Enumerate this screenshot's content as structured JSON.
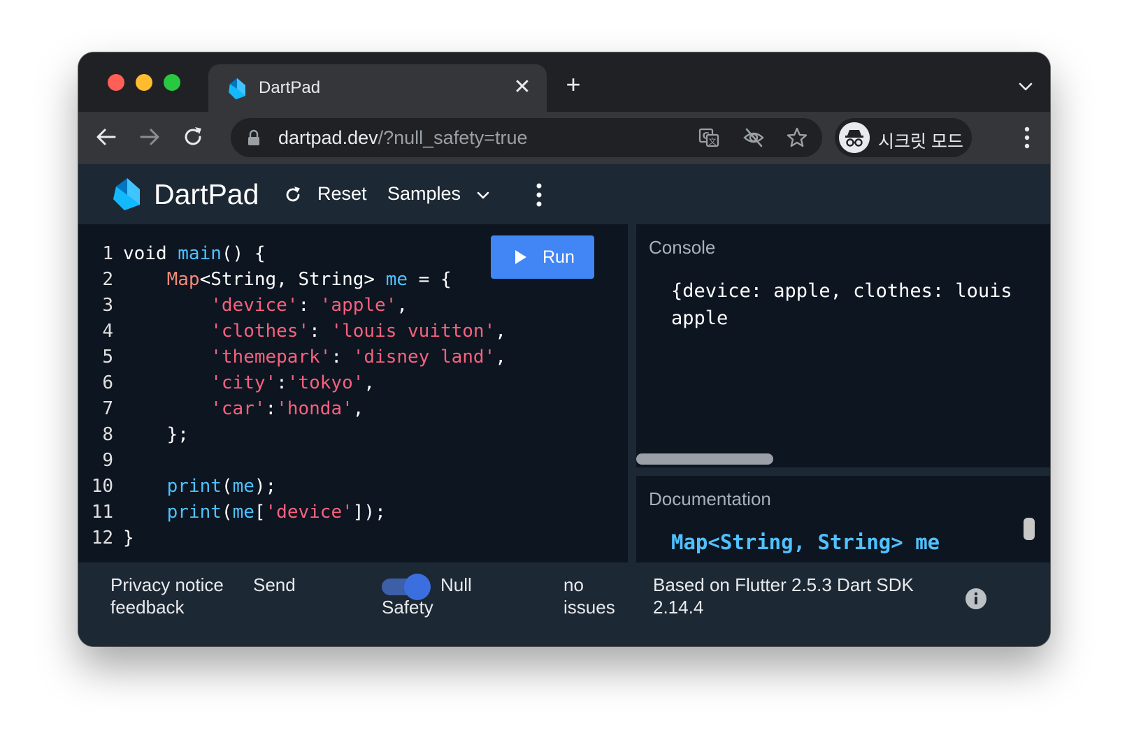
{
  "browser": {
    "tab_title": "DartPad",
    "tab_close": "✕",
    "new_tab": "+",
    "url_host": "dartpad.dev",
    "url_rest": "/?null_safety=true",
    "incognito_label": "시크릿 모드"
  },
  "app": {
    "title": "DartPad",
    "reset_label": "Reset",
    "samples_label": "Samples"
  },
  "editor": {
    "run_label": "Run",
    "lines": [
      {
        "n": "1",
        "tokens": [
          {
            "t": "void ",
            "c": "k"
          },
          {
            "t": "main",
            "c": "fn"
          },
          {
            "t": "() {",
            "c": "k"
          }
        ]
      },
      {
        "n": "2",
        "tokens": [
          {
            "t": "    ",
            "c": "k"
          },
          {
            "t": "Map",
            "c": "ty"
          },
          {
            "t": "<String, String> ",
            "c": "k"
          },
          {
            "t": "me",
            "c": "fn"
          },
          {
            "t": " = {",
            "c": "k"
          }
        ]
      },
      {
        "n": "3",
        "tokens": [
          {
            "t": "        ",
            "c": "k"
          },
          {
            "t": "'device'",
            "c": "st"
          },
          {
            "t": ": ",
            "c": "k"
          },
          {
            "t": "'apple'",
            "c": "st"
          },
          {
            "t": ",",
            "c": "k"
          }
        ]
      },
      {
        "n": "4",
        "tokens": [
          {
            "t": "        ",
            "c": "k"
          },
          {
            "t": "'clothes'",
            "c": "st"
          },
          {
            "t": ": ",
            "c": "k"
          },
          {
            "t": "'louis vuitton'",
            "c": "st"
          },
          {
            "t": ",",
            "c": "k"
          }
        ]
      },
      {
        "n": "5",
        "tokens": [
          {
            "t": "        ",
            "c": "k"
          },
          {
            "t": "'themepark'",
            "c": "st"
          },
          {
            "t": ": ",
            "c": "k"
          },
          {
            "t": "'disney land'",
            "c": "st"
          },
          {
            "t": ",",
            "c": "k"
          }
        ]
      },
      {
        "n": "6",
        "tokens": [
          {
            "t": "        ",
            "c": "k"
          },
          {
            "t": "'city'",
            "c": "st"
          },
          {
            "t": ":",
            "c": "k"
          },
          {
            "t": "'tokyo'",
            "c": "st"
          },
          {
            "t": ",",
            "c": "k"
          }
        ]
      },
      {
        "n": "7",
        "tokens": [
          {
            "t": "        ",
            "c": "k"
          },
          {
            "t": "'car'",
            "c": "st"
          },
          {
            "t": ":",
            "c": "k"
          },
          {
            "t": "'honda'",
            "c": "st"
          },
          {
            "t": ",",
            "c": "k"
          }
        ]
      },
      {
        "n": "8",
        "tokens": [
          {
            "t": "    };",
            "c": "k"
          }
        ]
      },
      {
        "n": "9",
        "tokens": []
      },
      {
        "n": "10",
        "tokens": [
          {
            "t": "    ",
            "c": "k"
          },
          {
            "t": "print",
            "c": "fn"
          },
          {
            "t": "(",
            "c": "k"
          },
          {
            "t": "me",
            "c": "fn"
          },
          {
            "t": ");",
            "c": "k"
          }
        ]
      },
      {
        "n": "11",
        "tokens": [
          {
            "t": "    ",
            "c": "k"
          },
          {
            "t": "print",
            "c": "fn"
          },
          {
            "t": "(",
            "c": "k"
          },
          {
            "t": "me",
            "c": "fn"
          },
          {
            "t": "[",
            "c": "k"
          },
          {
            "t": "'device'",
            "c": "st"
          },
          {
            "t": "]);",
            "c": "k"
          }
        ]
      },
      {
        "n": "12",
        "tokens": [
          {
            "t": "}",
            "c": "k"
          }
        ]
      }
    ]
  },
  "console": {
    "title": "Console",
    "lines": [
      "{device: apple, clothes: louis",
      "apple"
    ]
  },
  "docs": {
    "title": "Documentation",
    "signature": "Map<String, String> me"
  },
  "footer": {
    "privacy_line1": "Privacy notice",
    "privacy_line2": "feedback",
    "send": "Send",
    "null_line1": "Null",
    "null_line2": "Safety",
    "issues_line1": "no",
    "issues_line2": "issues",
    "sdk_line1": "Based on Flutter 2.5.3 Dart SDK",
    "sdk_line2": "2.14.4"
  },
  "colors": {
    "accent": "#4285f4",
    "keyword": "#ffffff",
    "function": "#4fc1ff",
    "type": "#f5897a",
    "string": "#f7617e"
  }
}
